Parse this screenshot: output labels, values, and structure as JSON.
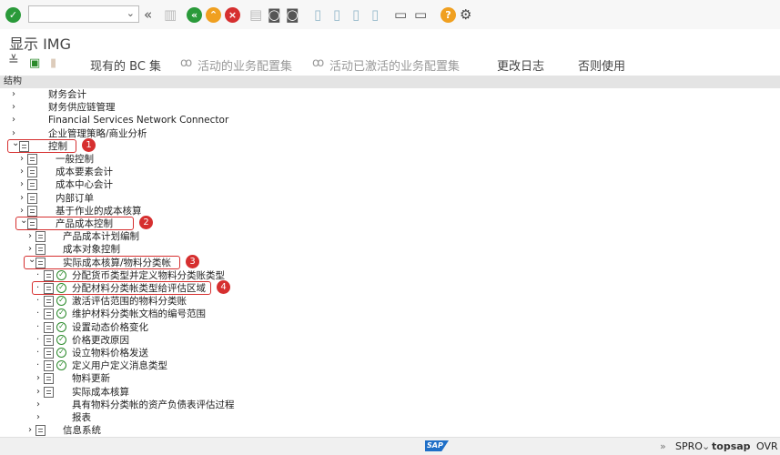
{
  "toolbar": {
    "command_value": "",
    "icons": [
      "enter-icon",
      "back-icon",
      "save-icon",
      "nav-back-icon",
      "exit-icon",
      "cancel-icon",
      "print-icon",
      "find-icon",
      "find-next-icon",
      "first-page-icon",
      "prev-page-icon",
      "next-page-icon",
      "last-page-icon",
      "new-session-icon",
      "shortcut-icon",
      "help-icon",
      "settings-icon"
    ]
  },
  "title": "显示 IMG",
  "app_toolbar": {
    "existing_bc": "现有的 BC 集",
    "active_bc": "活动的业务配置集",
    "activated_bc": "活动已激活的业务配置集",
    "change_log": "更改日志",
    "release_notes": "否则使用"
  },
  "structure_header": "结构",
  "tree": [
    {
      "label": "财务会计",
      "level": 0,
      "state": "collapsed",
      "icon": false
    },
    {
      "label": "财务供应链管理",
      "level": 0,
      "state": "collapsed",
      "icon": false
    },
    {
      "label": "Financial Services Network Connector",
      "level": 0,
      "state": "collapsed",
      "icon": false
    },
    {
      "label": "企业管理策略/商业分析",
      "level": 0,
      "state": "collapsed",
      "icon": false
    },
    {
      "label": "控制",
      "level": 0,
      "state": "expanded",
      "icon": true,
      "marker": "1"
    },
    {
      "label": "一般控制",
      "level": 1,
      "state": "collapsed",
      "icon": true
    },
    {
      "label": "成本要素会计",
      "level": 1,
      "state": "collapsed",
      "icon": true
    },
    {
      "label": "成本中心会计",
      "level": 1,
      "state": "collapsed",
      "icon": true
    },
    {
      "label": "内部订单",
      "level": 1,
      "state": "collapsed",
      "icon": true
    },
    {
      "label": "基于作业的成本核算",
      "level": 1,
      "state": "collapsed",
      "icon": true
    },
    {
      "label": "产品成本控制",
      "level": 1,
      "state": "expanded",
      "icon": true,
      "marker": "2"
    },
    {
      "label": "产品成本计划编制",
      "level": 2,
      "state": "collapsed",
      "icon": true
    },
    {
      "label": "成本对象控制",
      "level": 2,
      "state": "collapsed",
      "icon": true
    },
    {
      "label": "实际成本核算/物料分类帐",
      "level": 2,
      "state": "expanded",
      "icon": true,
      "marker": "3"
    },
    {
      "label": "分配货币类型并定义物料分类账类型",
      "level": 3,
      "state": "leaf",
      "icon": true,
      "clock": true
    },
    {
      "label": "分配材料分类帐类型给评估区域",
      "level": 3,
      "state": "leaf",
      "icon": true,
      "clock": true,
      "marker": "4"
    },
    {
      "label": "激活评估范围的物料分类账",
      "level": 3,
      "state": "leaf",
      "icon": true,
      "clock": true
    },
    {
      "label": "维护材料分类帐文档的编号范围",
      "level": 3,
      "state": "leaf",
      "icon": true,
      "clock": true
    },
    {
      "label": "设置动态价格变化",
      "level": 3,
      "state": "leaf",
      "icon": true,
      "clock": true
    },
    {
      "label": "价格更改原因",
      "level": 3,
      "state": "leaf",
      "icon": true,
      "clock": true
    },
    {
      "label": "设立物料价格发送",
      "level": 3,
      "state": "leaf",
      "icon": true,
      "clock": true
    },
    {
      "label": "定义用户定义消息类型",
      "level": 3,
      "state": "leaf",
      "icon": true,
      "clock": true
    },
    {
      "label": "物料更新",
      "level": 3,
      "state": "collapsed",
      "icon": true
    },
    {
      "label": "实际成本核算",
      "level": 3,
      "state": "collapsed",
      "icon": true
    },
    {
      "label": "具有物料分类帐的资产负债表评估过程",
      "level": 3,
      "state": "collapsed",
      "icon": false
    },
    {
      "label": "报表",
      "level": 3,
      "state": "collapsed",
      "icon": false
    },
    {
      "label": "信息系统",
      "level": 2,
      "state": "collapsed",
      "icon": true
    }
  ],
  "status": {
    "logo": "SAP",
    "more": "»",
    "transaction": "SPRO",
    "server": "topsap",
    "mode": "OVR"
  },
  "colors": {
    "highlight": "#d62f2f",
    "ok": "#2a9a3a",
    "exit": "#f0a020",
    "cancel": "#d62f2f"
  }
}
